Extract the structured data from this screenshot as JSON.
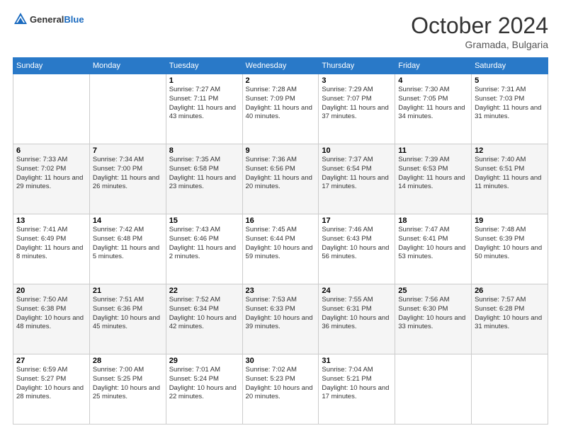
{
  "header": {
    "logo_general": "General",
    "logo_blue": "Blue",
    "month": "October 2024",
    "location": "Gramada, Bulgaria"
  },
  "days_of_week": [
    "Sunday",
    "Monday",
    "Tuesday",
    "Wednesday",
    "Thursday",
    "Friday",
    "Saturday"
  ],
  "weeks": [
    [
      {
        "day": "",
        "sunrise": "",
        "sunset": "",
        "daylight": ""
      },
      {
        "day": "",
        "sunrise": "",
        "sunset": "",
        "daylight": ""
      },
      {
        "day": "1",
        "sunrise": "Sunrise: 7:27 AM",
        "sunset": "Sunset: 7:11 PM",
        "daylight": "Daylight: 11 hours and 43 minutes."
      },
      {
        "day": "2",
        "sunrise": "Sunrise: 7:28 AM",
        "sunset": "Sunset: 7:09 PM",
        "daylight": "Daylight: 11 hours and 40 minutes."
      },
      {
        "day": "3",
        "sunrise": "Sunrise: 7:29 AM",
        "sunset": "Sunset: 7:07 PM",
        "daylight": "Daylight: 11 hours and 37 minutes."
      },
      {
        "day": "4",
        "sunrise": "Sunrise: 7:30 AM",
        "sunset": "Sunset: 7:05 PM",
        "daylight": "Daylight: 11 hours and 34 minutes."
      },
      {
        "day": "5",
        "sunrise": "Sunrise: 7:31 AM",
        "sunset": "Sunset: 7:03 PM",
        "daylight": "Daylight: 11 hours and 31 minutes."
      }
    ],
    [
      {
        "day": "6",
        "sunrise": "Sunrise: 7:33 AM",
        "sunset": "Sunset: 7:02 PM",
        "daylight": "Daylight: 11 hours and 29 minutes."
      },
      {
        "day": "7",
        "sunrise": "Sunrise: 7:34 AM",
        "sunset": "Sunset: 7:00 PM",
        "daylight": "Daylight: 11 hours and 26 minutes."
      },
      {
        "day": "8",
        "sunrise": "Sunrise: 7:35 AM",
        "sunset": "Sunset: 6:58 PM",
        "daylight": "Daylight: 11 hours and 23 minutes."
      },
      {
        "day": "9",
        "sunrise": "Sunrise: 7:36 AM",
        "sunset": "Sunset: 6:56 PM",
        "daylight": "Daylight: 11 hours and 20 minutes."
      },
      {
        "day": "10",
        "sunrise": "Sunrise: 7:37 AM",
        "sunset": "Sunset: 6:54 PM",
        "daylight": "Daylight: 11 hours and 17 minutes."
      },
      {
        "day": "11",
        "sunrise": "Sunrise: 7:39 AM",
        "sunset": "Sunset: 6:53 PM",
        "daylight": "Daylight: 11 hours and 14 minutes."
      },
      {
        "day": "12",
        "sunrise": "Sunrise: 7:40 AM",
        "sunset": "Sunset: 6:51 PM",
        "daylight": "Daylight: 11 hours and 11 minutes."
      }
    ],
    [
      {
        "day": "13",
        "sunrise": "Sunrise: 7:41 AM",
        "sunset": "Sunset: 6:49 PM",
        "daylight": "Daylight: 11 hours and 8 minutes."
      },
      {
        "day": "14",
        "sunrise": "Sunrise: 7:42 AM",
        "sunset": "Sunset: 6:48 PM",
        "daylight": "Daylight: 11 hours and 5 minutes."
      },
      {
        "day": "15",
        "sunrise": "Sunrise: 7:43 AM",
        "sunset": "Sunset: 6:46 PM",
        "daylight": "Daylight: 11 hours and 2 minutes."
      },
      {
        "day": "16",
        "sunrise": "Sunrise: 7:45 AM",
        "sunset": "Sunset: 6:44 PM",
        "daylight": "Daylight: 10 hours and 59 minutes."
      },
      {
        "day": "17",
        "sunrise": "Sunrise: 7:46 AM",
        "sunset": "Sunset: 6:43 PM",
        "daylight": "Daylight: 10 hours and 56 minutes."
      },
      {
        "day": "18",
        "sunrise": "Sunrise: 7:47 AM",
        "sunset": "Sunset: 6:41 PM",
        "daylight": "Daylight: 10 hours and 53 minutes."
      },
      {
        "day": "19",
        "sunrise": "Sunrise: 7:48 AM",
        "sunset": "Sunset: 6:39 PM",
        "daylight": "Daylight: 10 hours and 50 minutes."
      }
    ],
    [
      {
        "day": "20",
        "sunrise": "Sunrise: 7:50 AM",
        "sunset": "Sunset: 6:38 PM",
        "daylight": "Daylight: 10 hours and 48 minutes."
      },
      {
        "day": "21",
        "sunrise": "Sunrise: 7:51 AM",
        "sunset": "Sunset: 6:36 PM",
        "daylight": "Daylight: 10 hours and 45 minutes."
      },
      {
        "day": "22",
        "sunrise": "Sunrise: 7:52 AM",
        "sunset": "Sunset: 6:34 PM",
        "daylight": "Daylight: 10 hours and 42 minutes."
      },
      {
        "day": "23",
        "sunrise": "Sunrise: 7:53 AM",
        "sunset": "Sunset: 6:33 PM",
        "daylight": "Daylight: 10 hours and 39 minutes."
      },
      {
        "day": "24",
        "sunrise": "Sunrise: 7:55 AM",
        "sunset": "Sunset: 6:31 PM",
        "daylight": "Daylight: 10 hours and 36 minutes."
      },
      {
        "day": "25",
        "sunrise": "Sunrise: 7:56 AM",
        "sunset": "Sunset: 6:30 PM",
        "daylight": "Daylight: 10 hours and 33 minutes."
      },
      {
        "day": "26",
        "sunrise": "Sunrise: 7:57 AM",
        "sunset": "Sunset: 6:28 PM",
        "daylight": "Daylight: 10 hours and 31 minutes."
      }
    ],
    [
      {
        "day": "27",
        "sunrise": "Sunrise: 6:59 AM",
        "sunset": "Sunset: 5:27 PM",
        "daylight": "Daylight: 10 hours and 28 minutes."
      },
      {
        "day": "28",
        "sunrise": "Sunrise: 7:00 AM",
        "sunset": "Sunset: 5:25 PM",
        "daylight": "Daylight: 10 hours and 25 minutes."
      },
      {
        "day": "29",
        "sunrise": "Sunrise: 7:01 AM",
        "sunset": "Sunset: 5:24 PM",
        "daylight": "Daylight: 10 hours and 22 minutes."
      },
      {
        "day": "30",
        "sunrise": "Sunrise: 7:02 AM",
        "sunset": "Sunset: 5:23 PM",
        "daylight": "Daylight: 10 hours and 20 minutes."
      },
      {
        "day": "31",
        "sunrise": "Sunrise: 7:04 AM",
        "sunset": "Sunset: 5:21 PM",
        "daylight": "Daylight: 10 hours and 17 minutes."
      },
      {
        "day": "",
        "sunrise": "",
        "sunset": "",
        "daylight": ""
      },
      {
        "day": "",
        "sunrise": "",
        "sunset": "",
        "daylight": ""
      }
    ]
  ]
}
